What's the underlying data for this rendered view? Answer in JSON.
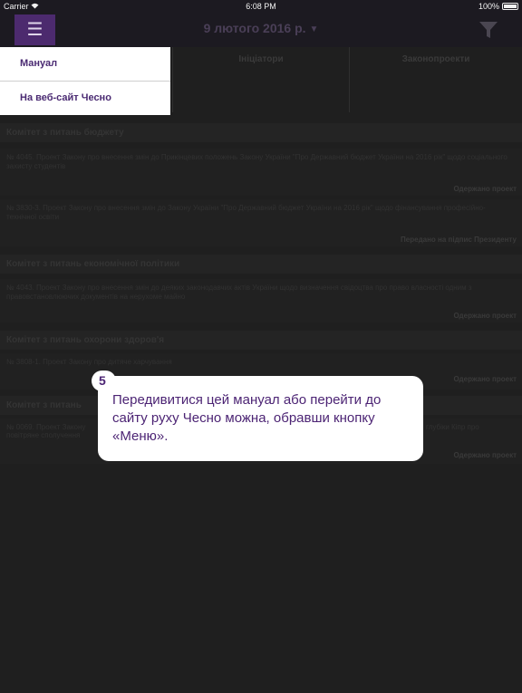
{
  "status_bar": {
    "carrier": "Carrier",
    "wifi_icon": "wifi-icon",
    "time": "6:08 PM",
    "battery": "100%"
  },
  "nav": {
    "menu_icon": "☰",
    "date": "9 лютого 2016 р.",
    "caret": "▼",
    "filter_icon": "filter-icon"
  },
  "tabs": [
    {
      "label": "Ініціатори"
    },
    {
      "label": "Законопроекти"
    }
  ],
  "sections": [
    {
      "title": "Комітет з питань бюджету",
      "items": [
        {
          "text": "№ 4045. Проект Закону про внесення змін до Прикінцевих положень Закону України \"Про Державний бюджет України на 2016 рік\" щодо соціального захисту студентів",
          "status": "Одержано проект"
        },
        {
          "text": "№ 3830-3. Проект Закону про внесення змін до Закону України \"Про Державний бюджет України на 2016 рік\" щодо фінансування професійно-технічної освіти",
          "status": "Передано на підпис Президенту"
        }
      ]
    },
    {
      "title": "Комітет з питань економічної політики",
      "items": [
        {
          "text": "№ 4043. Проект Закону про внесення змін до деяких законодавчих актів України щодо визначення свідоцтва про право власності одним з правовстановлюючих документів на нерухоме майно",
          "status": "Одержано проект"
        }
      ]
    },
    {
      "title": "Комітет з питань охорони здоров'я",
      "items": [
        {
          "text": "№ 3808-1. Проект Закону про дитяче харчування",
          "status": "Одержано проект"
        }
      ]
    },
    {
      "title": "Комітет з питань",
      "items": [
        {
          "text": "№ 0069. Проект Закону",
          "text_right": "глубіки Кіпр про",
          "text_line2": "повітряне сполучення",
          "status": "Одержано проект"
        }
      ]
    }
  ],
  "menu": {
    "items": [
      {
        "label": "Мануал"
      },
      {
        "label": "На веб-сайт Чесно"
      }
    ]
  },
  "tooltip": {
    "step": "5",
    "text": "Передивитися цей мануал або перейти до сайту руху Чесно можна, обравши кнопку «Меню»."
  }
}
